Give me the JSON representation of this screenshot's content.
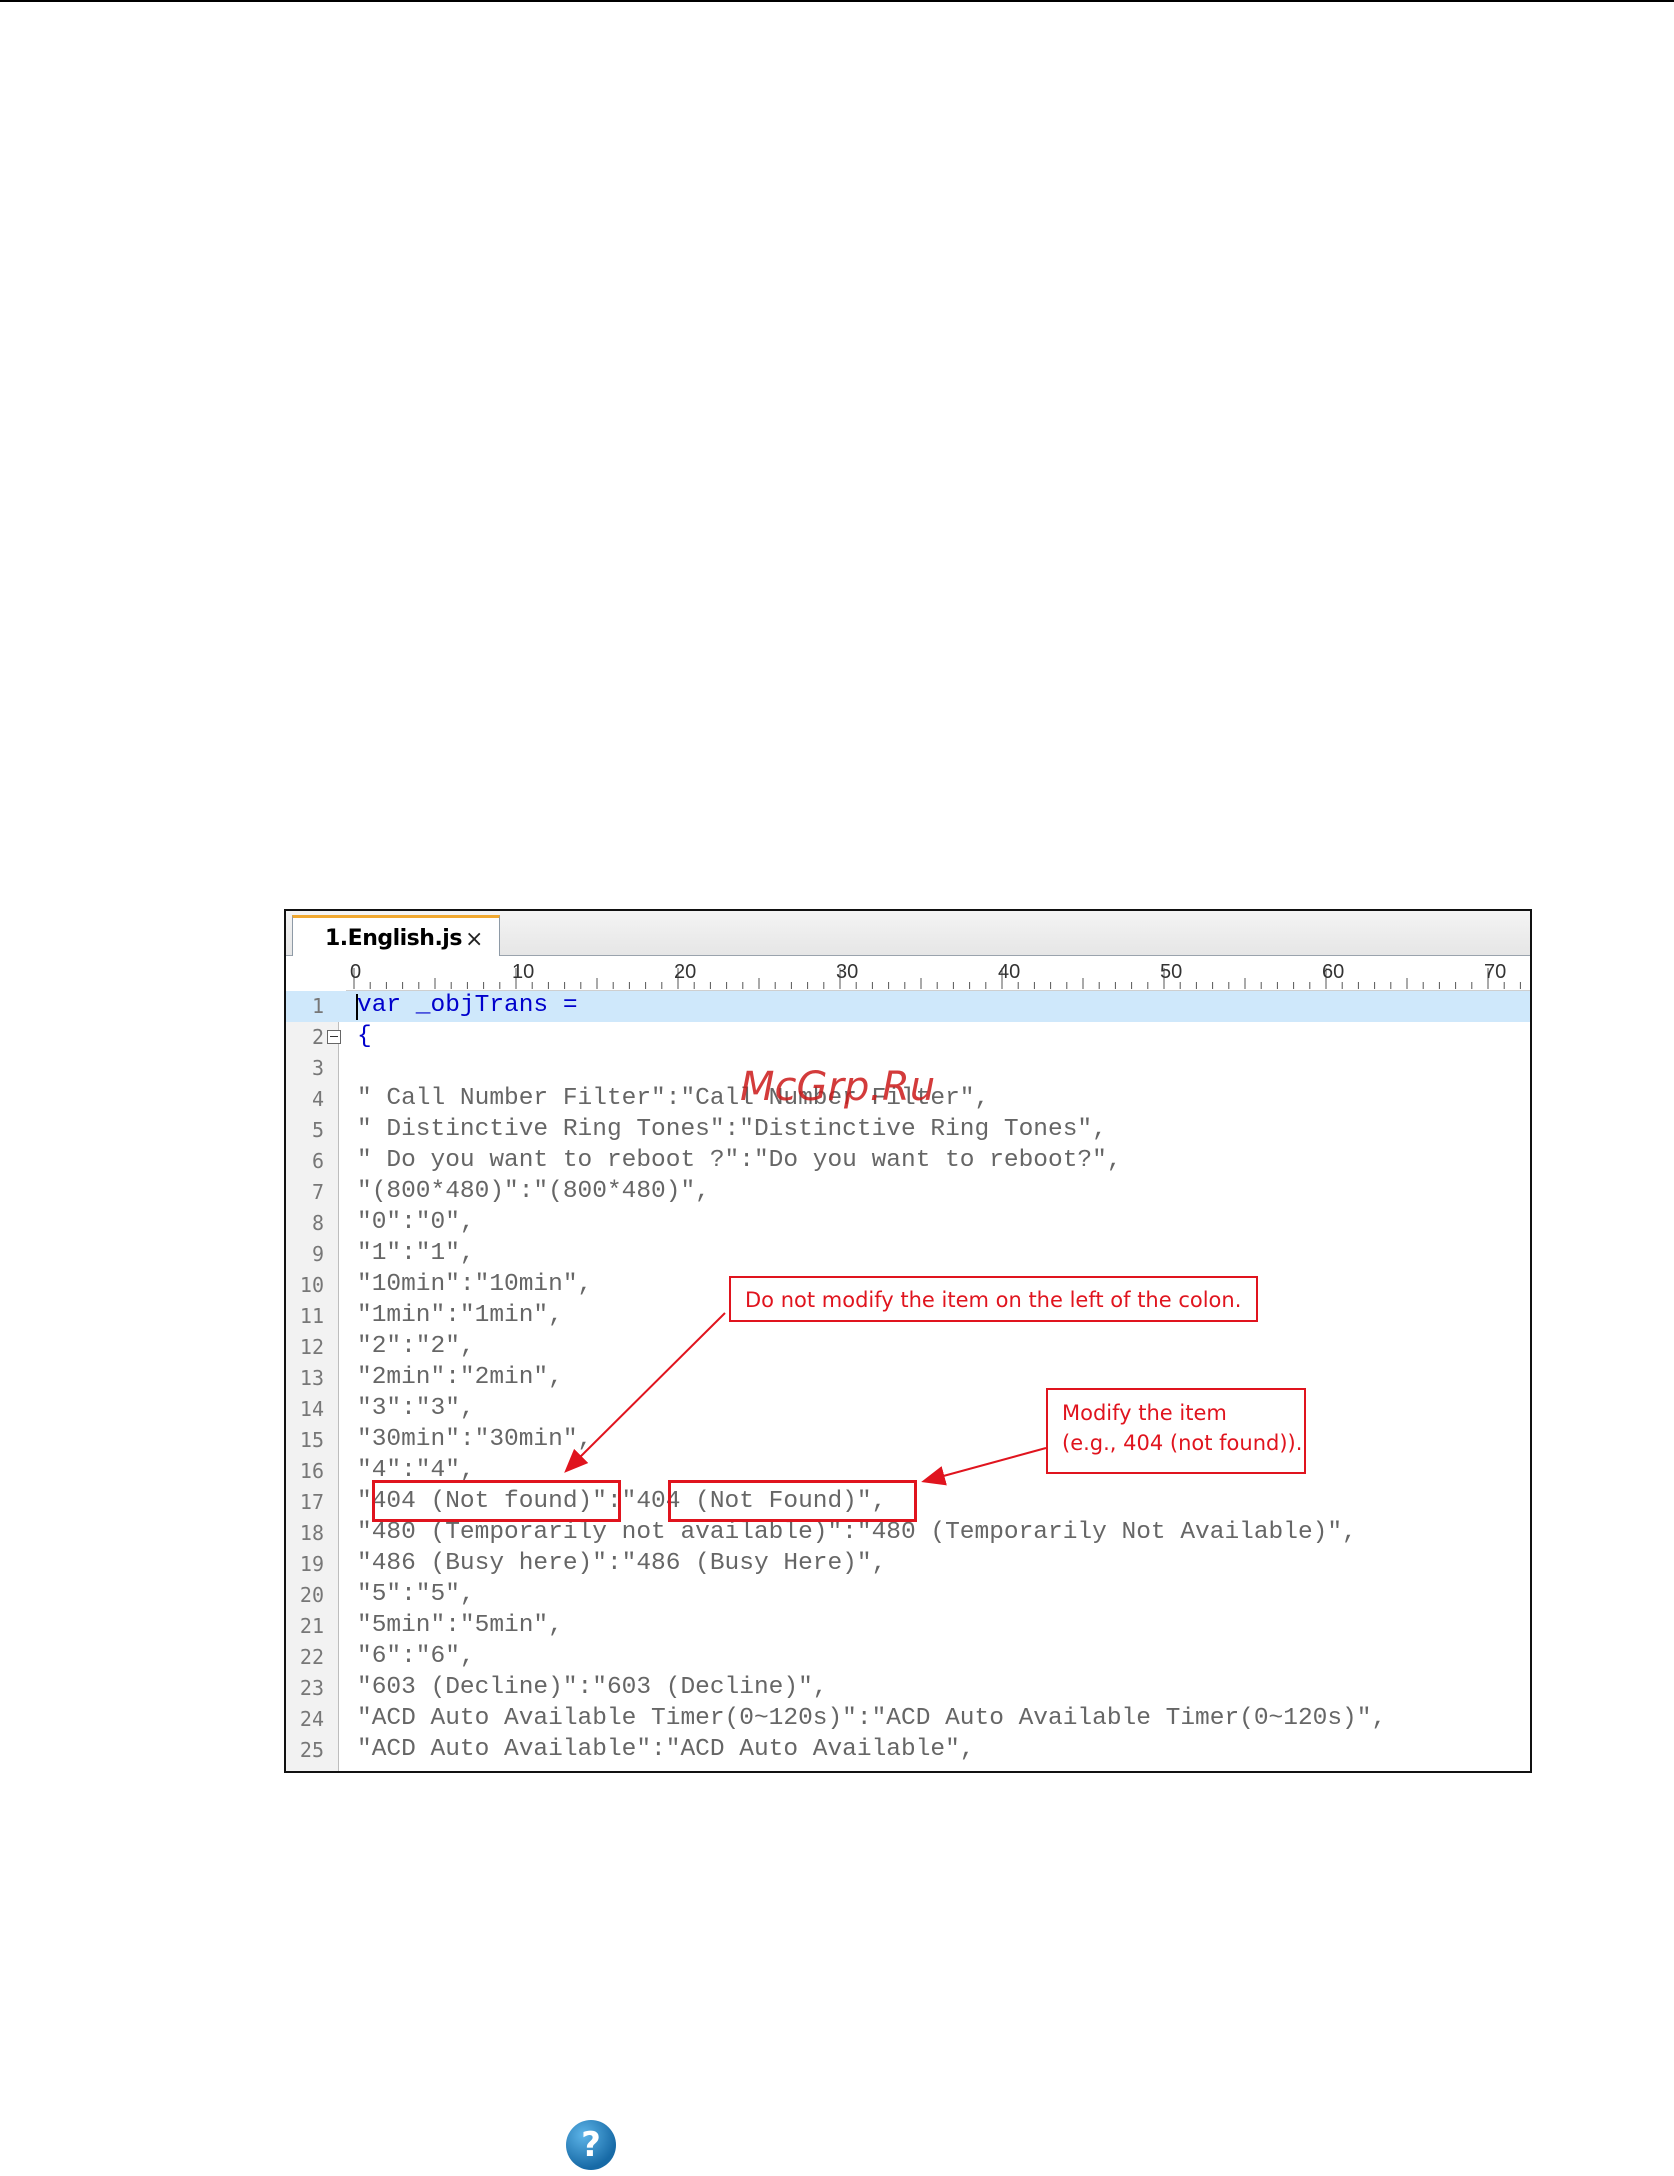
{
  "editor": {
    "tab": {
      "title": "1.English.js",
      "close_glyph": "×"
    },
    "ruler": {
      "labels": [
        "0",
        "10",
        "20",
        "30",
        "40",
        "50",
        "60",
        "70"
      ]
    },
    "lines": [
      {
        "num": "1",
        "text": "var _objTrans ="
      },
      {
        "num": "2",
        "text": "{"
      },
      {
        "num": "3",
        "text": ""
      },
      {
        "num": "4",
        "text": "\" Call Number Filter\":\"Call Number Filter\","
      },
      {
        "num": "5",
        "text": "\" Distinctive Ring Tones\":\"Distinctive Ring Tones\","
      },
      {
        "num": "6",
        "text": "\" Do you want to reboot ?\":\"Do you want to reboot?\","
      },
      {
        "num": "7",
        "text": "\"(800*480)\":\"(800*480)\","
      },
      {
        "num": "8",
        "text": "\"0\":\"0\","
      },
      {
        "num": "9",
        "text": "\"1\":\"1\","
      },
      {
        "num": "10",
        "text": "\"10min\":\"10min\","
      },
      {
        "num": "11",
        "text": "\"1min\":\"1min\","
      },
      {
        "num": "12",
        "text": "\"2\":\"2\","
      },
      {
        "num": "13",
        "text": "\"2min\":\"2min\","
      },
      {
        "num": "14",
        "text": "\"3\":\"3\","
      },
      {
        "num": "15",
        "text": "\"30min\":\"30min\","
      },
      {
        "num": "16",
        "text": "\"4\":\"4\","
      },
      {
        "num": "17",
        "text": "\"404 (Not found)\":\"404 (Not Found)\","
      },
      {
        "num": "18",
        "text": "\"480 (Temporarily not available)\":\"480 (Temporarily Not Available)\","
      },
      {
        "num": "19",
        "text": "\"486 (Busy here)\":\"486 (Busy Here)\","
      },
      {
        "num": "20",
        "text": "\"5\":\"5\","
      },
      {
        "num": "21",
        "text": "\"5min\":\"5min\","
      },
      {
        "num": "22",
        "text": "\"6\":\"6\","
      },
      {
        "num": "23",
        "text": "\"603 (Decline)\":\"603 (Decline)\","
      },
      {
        "num": "24",
        "text": "\"ACD Auto Available Timer(0~120s)\":\"ACD Auto Available Timer(0~120s)\","
      },
      {
        "num": "25",
        "text": "\"ACD Auto Available\":\"ACD Auto Available\","
      }
    ]
  },
  "annotations": {
    "left_note": "Do not modify the item on the left of the colon.",
    "right_note": "Modify the item\n(e.g., 404 (not found))."
  },
  "watermark": "McGrp.Ru",
  "help_icon": {
    "glyph": "?",
    "icon": "help-icon"
  },
  "colors": {
    "annotation_red": "#e0141e",
    "current_line": "#cfe8fb",
    "keyword": "#0000cc"
  }
}
